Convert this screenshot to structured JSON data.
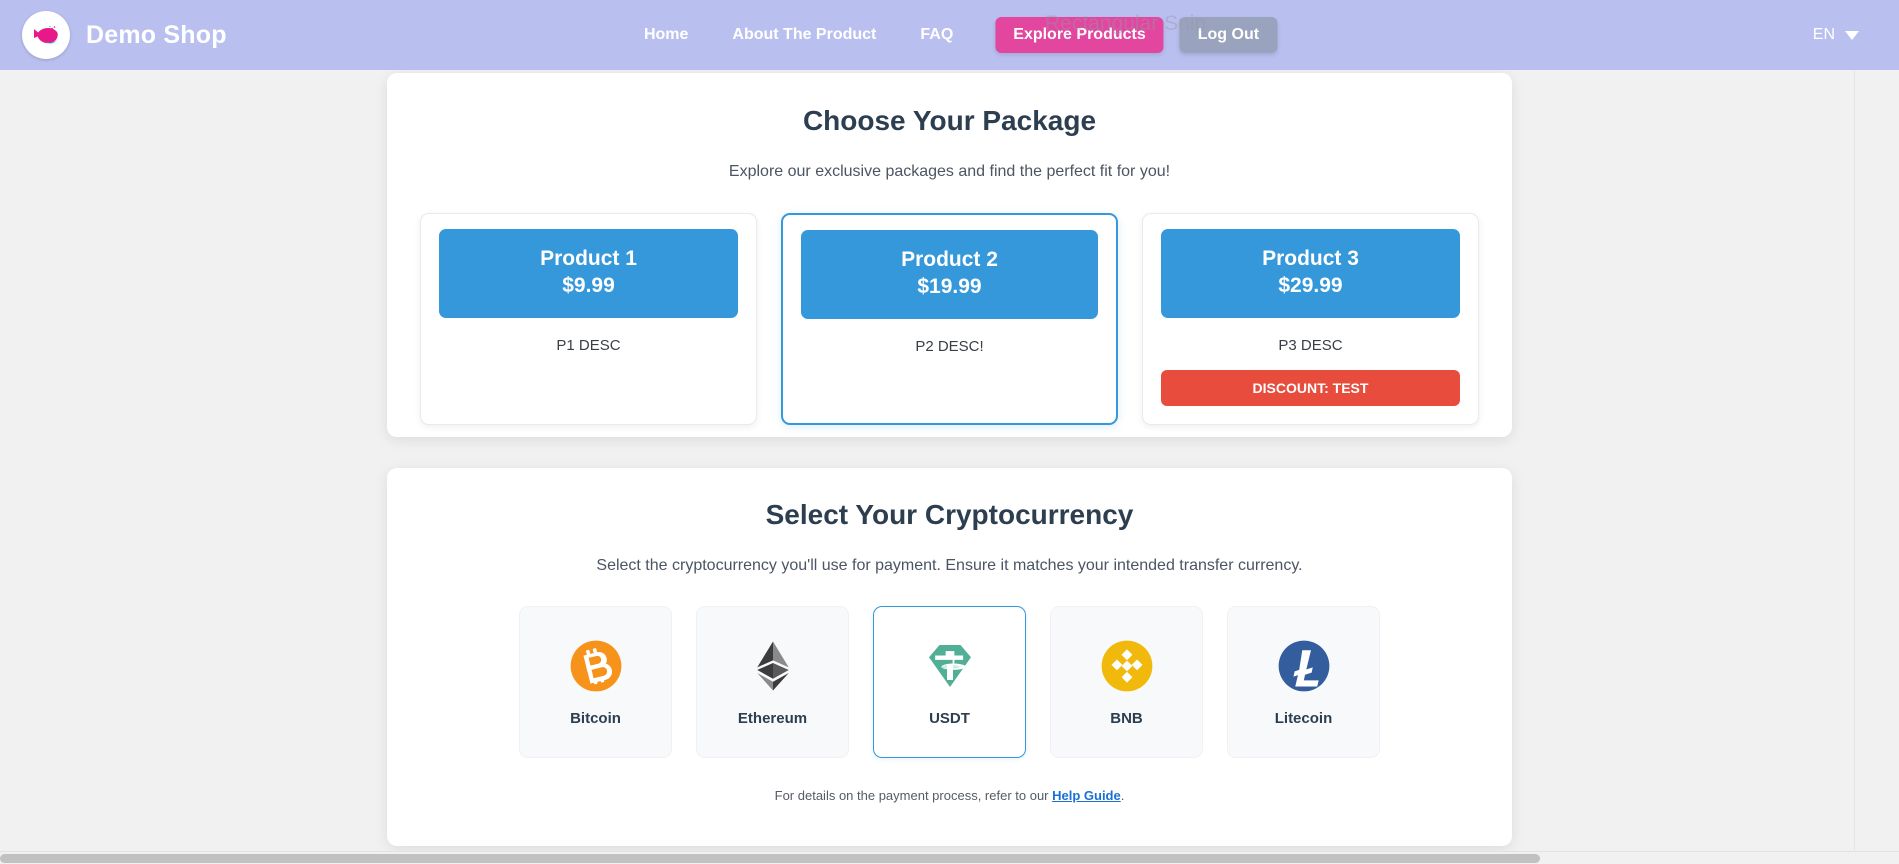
{
  "header": {
    "brand_name": "Demo Shop",
    "logo_icon": "whale-logo-icon",
    "nav_links": [
      {
        "label": "Home",
        "name": "nav-link-home"
      },
      {
        "label": "About The Product",
        "name": "nav-link-about-the-product"
      },
      {
        "label": "FAQ",
        "name": "nav-link-faq"
      }
    ],
    "explore_button": "Explore Products",
    "logout_button": "Log Out",
    "language": "EN",
    "language_caret_icon": "chevron-down-icon",
    "watermark": "Rectangular Snip",
    "colors": {
      "navbar_bg": "#b9c0f0",
      "explore_btn": "#e2469f",
      "logout_btn": "#9aa3bd",
      "brand_text": "#ffffff"
    }
  },
  "packages": {
    "title": "Choose Your Package",
    "subtitle": "Explore our exclusive packages and find the perfect fit for you!",
    "items": [
      {
        "name": "Product 1",
        "price": "$9.99",
        "desc": "P1 DESC",
        "selected": false,
        "discount": null
      },
      {
        "name": "Product 2",
        "price": "$19.99",
        "desc": "P2 DESC!",
        "selected": true,
        "discount": null
      },
      {
        "name": "Product 3",
        "price": "$29.99",
        "desc": "P3 DESC",
        "selected": false,
        "discount": "DISCOUNT: TEST"
      }
    ],
    "colors": {
      "head_bg": "#3498db",
      "selected_border": "#3498db",
      "discount_bg": "#e74c3c",
      "title": "#2c3e50"
    }
  },
  "crypto": {
    "title": "Select Your Cryptocurrency",
    "subtitle": "Select the cryptocurrency you'll use for payment. Ensure it matches your intended transfer currency.",
    "options": [
      {
        "label": "Bitcoin",
        "icon": "bitcoin-icon",
        "color": "#f7931a",
        "selected": false
      },
      {
        "label": "Ethereum",
        "icon": "ethereum-icon",
        "color": "#3c3c3d",
        "selected": false
      },
      {
        "label": "USDT",
        "icon": "tether-icon",
        "color": "#50af95",
        "selected": true
      },
      {
        "label": "BNB",
        "icon": "bnb-icon",
        "color": "#f0b90b",
        "selected": false
      },
      {
        "label": "Litecoin",
        "icon": "litecoin-icon",
        "color": "#345d9d",
        "selected": false
      }
    ],
    "help_prefix": "For details on the payment process, refer to our ",
    "help_link": "Help Guide",
    "help_suffix": "."
  }
}
